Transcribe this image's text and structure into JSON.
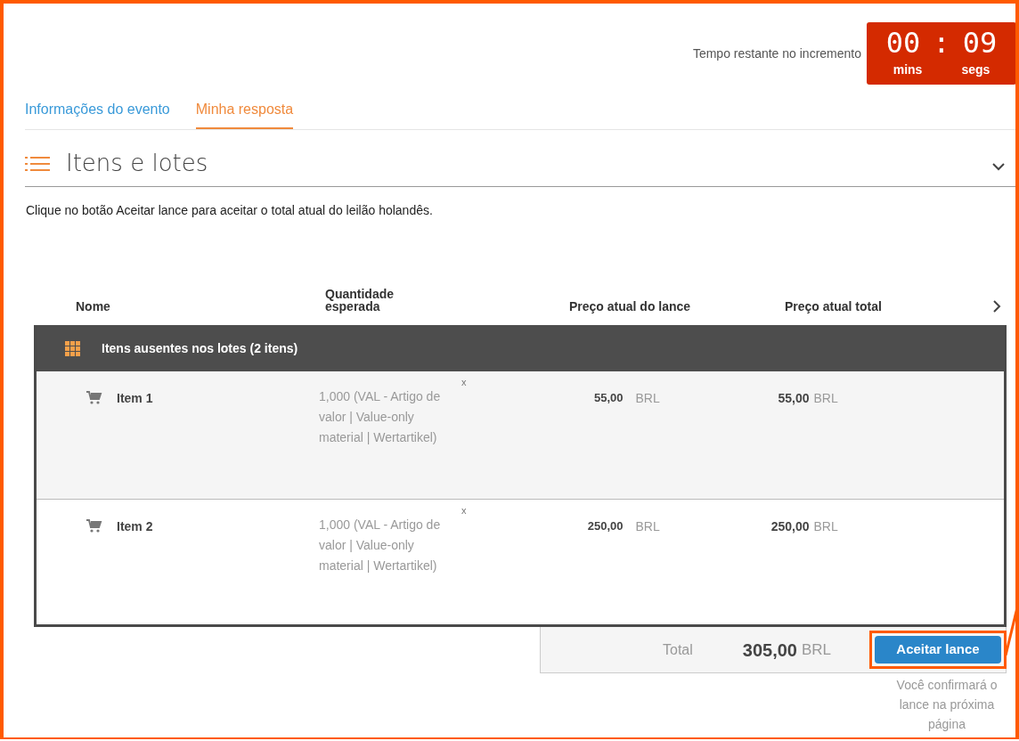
{
  "timer": {
    "label": "Tempo restante no incremento",
    "minutes": "00",
    "separator": ":",
    "seconds": "09",
    "minutes_unit": "mins",
    "seconds_unit": "segs"
  },
  "tabs": [
    {
      "label": "Informações do evento",
      "selected": false
    },
    {
      "label": "Minha resposta",
      "selected": true
    }
  ],
  "section": {
    "title": "Itens e lotes",
    "expanded": true,
    "instruction": "Clique no botão Aceitar lance para aceitar o total atual do leilão holandês."
  },
  "table": {
    "columns": [
      "Nome",
      "Quantidade esperada",
      "Preço atual do lance",
      "Preço atual total"
    ],
    "group": {
      "title": "Itens ausentes nos lotes (2 itens)"
    },
    "rows": [
      {
        "name": "Item 1",
        "quantity": "1,000 (VAL - Artigo de valor | Value-only material | Wertartikel)",
        "mark": "x",
        "bid_price": "55,00",
        "bid_currency": "BRL",
        "total_price": "55,00",
        "total_currency": "BRL"
      },
      {
        "name": "Item 2",
        "quantity": "1,000 (VAL - Artigo de valor | Value-only material | Wertartikel)",
        "mark": "x",
        "bid_price": "250,00",
        "bid_currency": "BRL",
        "total_price": "250,00",
        "total_currency": "BRL"
      }
    ]
  },
  "footer": {
    "total_label": "Total",
    "total_value": "305,00",
    "total_currency": "BRL",
    "button": "Aceitar lance",
    "note": "Você confirmará o lance na próxima página"
  }
}
